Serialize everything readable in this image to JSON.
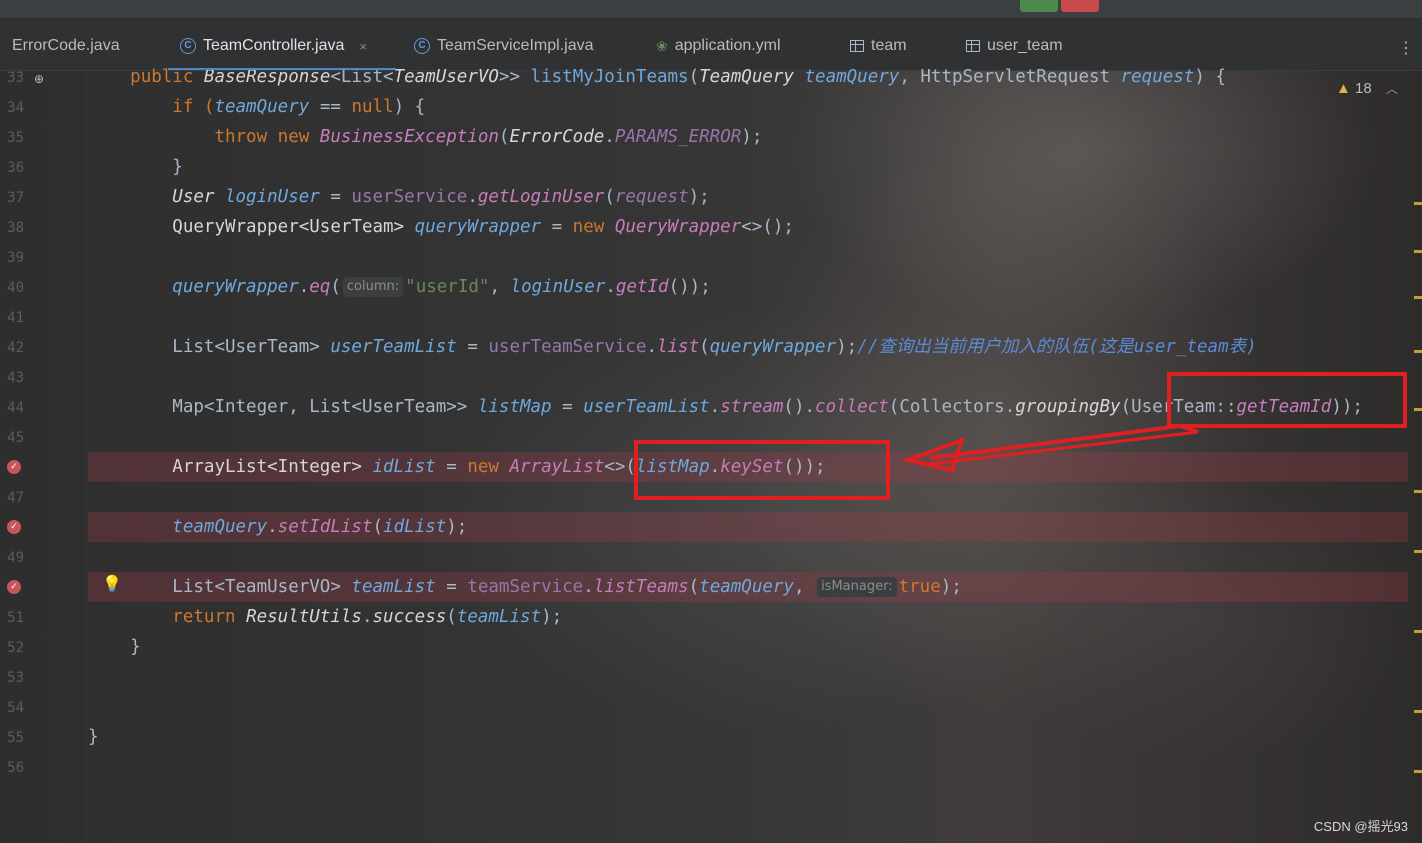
{
  "tabs": [
    {
      "label": "ErrorCode.java",
      "icon": "none"
    },
    {
      "label": "TeamController.java",
      "icon": "class-icon",
      "active": true
    },
    {
      "label": "TeamServiceImpl.java",
      "icon": "class-icon"
    },
    {
      "label": "application.yml",
      "icon": "yaml-icon"
    },
    {
      "label": "team",
      "icon": "table-icon"
    },
    {
      "label": "user_team",
      "icon": "table-icon"
    }
  ],
  "tab_close_glyph": "×",
  "more_glyph": "⋮",
  "line_numbers": [
    "33",
    "34",
    "35",
    "36",
    "37",
    "38",
    "39",
    "40",
    "41",
    "42",
    "43",
    "44",
    "45",
    "46",
    "47",
    "48",
    "49",
    "50",
    "51",
    "52",
    "53",
    "54",
    "55",
    "56"
  ],
  "code": {
    "l33": {
      "a": "public ",
      "b": "BaseResponse",
      "c": "<List<",
      "d": "TeamUserVO",
      "e": ">> ",
      "f": "listMyJoinTeams",
      "g": "(",
      "h": "TeamQuery ",
      "i": "teamQuery",
      "j": ", HttpServletRequest ",
      "k": "request",
      "l": ") {"
    },
    "l34": {
      "a": "if (",
      "b": "teamQuery",
      "c": " == ",
      "d": "null",
      "e": ") {"
    },
    "l35": {
      "a": "throw new ",
      "b": "BusinessException",
      "c": "(",
      "d": "ErrorCode",
      "e": ".",
      "f": "PARAMS_ERROR",
      "g": ");"
    },
    "l36": {
      "a": "}"
    },
    "l37": {
      "a": "User ",
      "b": "loginUser",
      "c": " = ",
      "d": "userService",
      "e": ".",
      "f": "getLoginUser",
      "g": "(",
      "h": "request",
      "i": ");"
    },
    "l38": {
      "a": "QueryWrapper<UserTeam> ",
      "b": "queryWrapper",
      "c": " = ",
      "d": "new ",
      "e": "QueryWrapper",
      "f": "<>();"
    },
    "l40": {
      "a": "queryWrapper",
      "b": ".",
      "c": "eq",
      "d": "(",
      "hint": "column:",
      "e": "\"userId\"",
      "f": ", ",
      "g": "loginUser",
      "h": ".",
      "i": "getId",
      "j": "());"
    },
    "l42": {
      "a": "List<UserTeam> ",
      "b": "userTeamList",
      "c": " = ",
      "d": "userTeamService",
      "e": ".",
      "f": "list",
      "g": "(",
      "h": "queryWrapper",
      "i": ");",
      "j": "//查询出当前用户加入的队伍(这是user_team表)"
    },
    "l44": {
      "a": "Map<Integer, List<UserTeam>> ",
      "b": "listMap",
      "c": " = ",
      "d": "userTeamList",
      "e": ".",
      "f": "stream",
      "g": "().",
      "h": "collect",
      "i": "(Collectors.",
      "j": "groupingBy",
      "k": "(UserTeam::",
      "l": "getTeamId",
      "m": "));"
    },
    "l46": {
      "a": "ArrayList<Integer> ",
      "b": "idList",
      "c": " = ",
      "d": "new ",
      "e": "ArrayList",
      "f": "<>(",
      "g": "listMap",
      "h": ".",
      "i": "keySet",
      "j": "());"
    },
    "l48": {
      "a": "teamQuery",
      "b": ".",
      "c": "setIdList",
      "d": "(",
      "e": "idList",
      "f": ");"
    },
    "l50": {
      "a": "List<TeamUserVO> ",
      "b": "teamList",
      "c": " = ",
      "d": "teamService",
      "e": ".",
      "f": "listTeams",
      "g": "(",
      "h": "teamQuery",
      "i": ", ",
      "hint": "isManager:",
      "j": "true",
      "k": ");"
    },
    "l51": {
      "a": "return ",
      "b": "ResultUtils",
      "c": ".",
      "d": "success",
      "e": "(",
      "f": "teamList",
      "g": ");"
    },
    "l52": {
      "a": "}"
    },
    "l55": {
      "a": "}"
    }
  },
  "inspection": {
    "warning_count": "18"
  },
  "watermark": "CSDN @摇光93",
  "colors": {
    "annotation_red": "#e02020",
    "breakpoint_line": "#9b3c46",
    "keyword": "#cc7832"
  }
}
